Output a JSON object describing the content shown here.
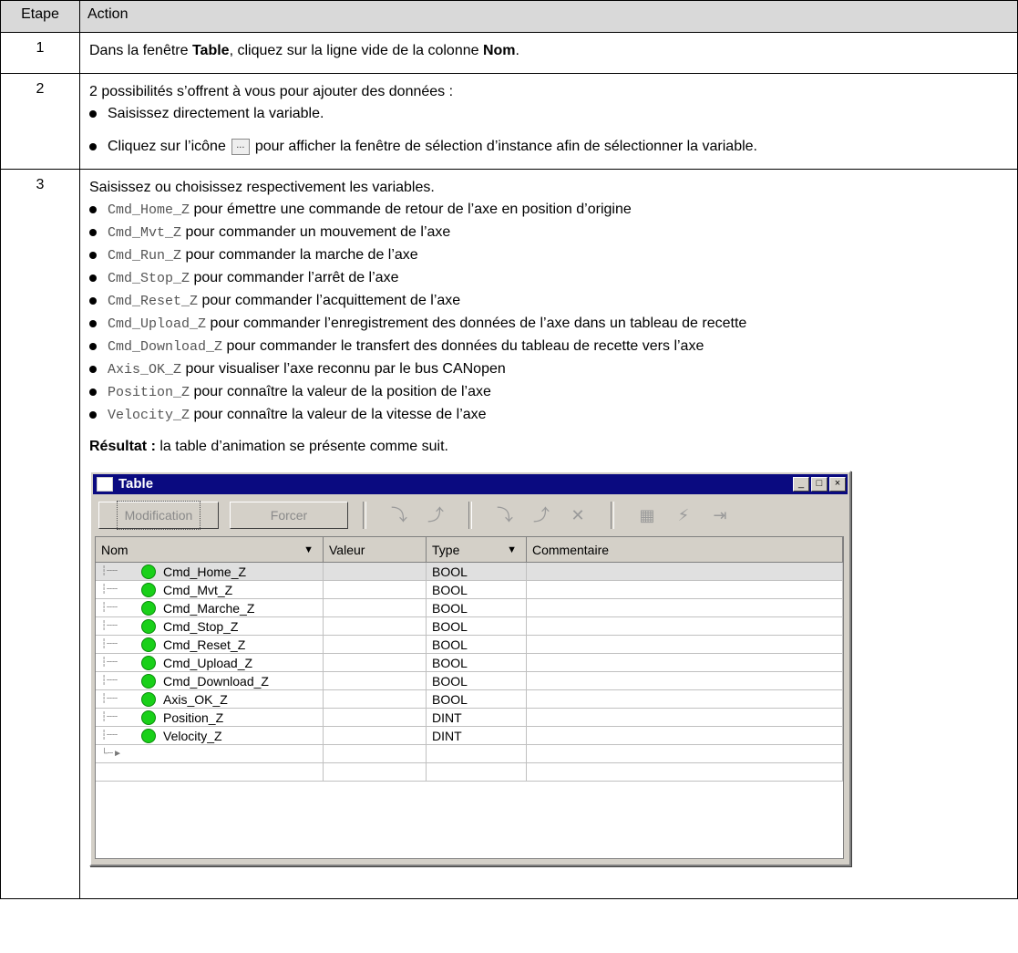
{
  "headers": {
    "step": "Etape",
    "action": "Action"
  },
  "rows": [
    {
      "step": "1",
      "line_a": "Dans la fenêtre ",
      "bold_a": "Table",
      "line_b": ", cliquez sur la ligne vide de la colonne ",
      "bold_b": "Nom",
      "line_c": "."
    },
    {
      "step": "2",
      "intro": "2 possibilités s’offrent à vous pour ajouter des données :",
      "bullet1": "Saisissez directement la variable.",
      "bullet2_pre": "Cliquez sur l’icône",
      "bullet2_icon": "...",
      "bullet2_post": "pour afficher la fenêtre de sélection d’instance afin de sélectionner la variable."
    },
    {
      "step": "3",
      "intro": "Saisissez ou choisissez respectivement les variables.",
      "vars": [
        {
          "code": "Cmd_Home_Z",
          "desc": "pour émettre une commande de retour de l’axe en position d’origine"
        },
        {
          "code": "Cmd_Mvt_Z",
          "desc": "pour commander un mouvement de l’axe"
        },
        {
          "code": "Cmd_Run_Z",
          "desc": "pour commander la marche de l’axe"
        },
        {
          "code": "Cmd_Stop_Z",
          "desc": "pour commander l’arrêt de l’axe"
        },
        {
          "code": "Cmd_Reset_Z",
          "desc": "pour commander l’acquittement de l’axe"
        },
        {
          "code": "Cmd_Upload_Z",
          "desc": "pour commander l’enregistrement des données de l’axe dans un tableau de recette"
        },
        {
          "code": "Cmd_Download_Z",
          "desc": "pour commander le transfert des données du tableau de recette vers l’axe"
        },
        {
          "code": "Axis_OK_Z",
          "desc": "pour visualiser l’axe reconnu par le bus CANopen"
        },
        {
          "code": "Position_Z",
          "desc": "pour connaître la valeur de la position de l’axe"
        },
        {
          "code": "Velocity_Z",
          "desc": "pour connaître la valeur de la vitesse de l’axe"
        }
      ],
      "result_label": "Résultat :",
      "result_text": "la table d’animation se présente comme suit."
    }
  ],
  "window": {
    "title": "Table",
    "buttons": {
      "modification": "Modification",
      "forcer": "Forcer"
    },
    "columns": {
      "nom": "Nom",
      "valeur": "Valeur",
      "type": "Type",
      "commentaire": "Commentaire"
    },
    "entries": [
      {
        "name": "Cmd_Home_Z",
        "type": "BOOL"
      },
      {
        "name": "Cmd_Mvt_Z",
        "type": "BOOL"
      },
      {
        "name": "Cmd_Marche_Z",
        "type": "BOOL"
      },
      {
        "name": "Cmd_Stop_Z",
        "type": "BOOL"
      },
      {
        "name": "Cmd_Reset_Z",
        "type": "BOOL"
      },
      {
        "name": "Cmd_Upload_Z",
        "type": "BOOL"
      },
      {
        "name": "Cmd_Download_Z",
        "type": "BOOL"
      },
      {
        "name": "Axis_OK_Z",
        "type": "BOOL"
      },
      {
        "name": "Position_Z",
        "type": "DINT"
      },
      {
        "name": "Velocity_Z",
        "type": "DINT"
      }
    ],
    "status_color": "#19d019",
    "title_bar_color": "#0a0a80"
  }
}
